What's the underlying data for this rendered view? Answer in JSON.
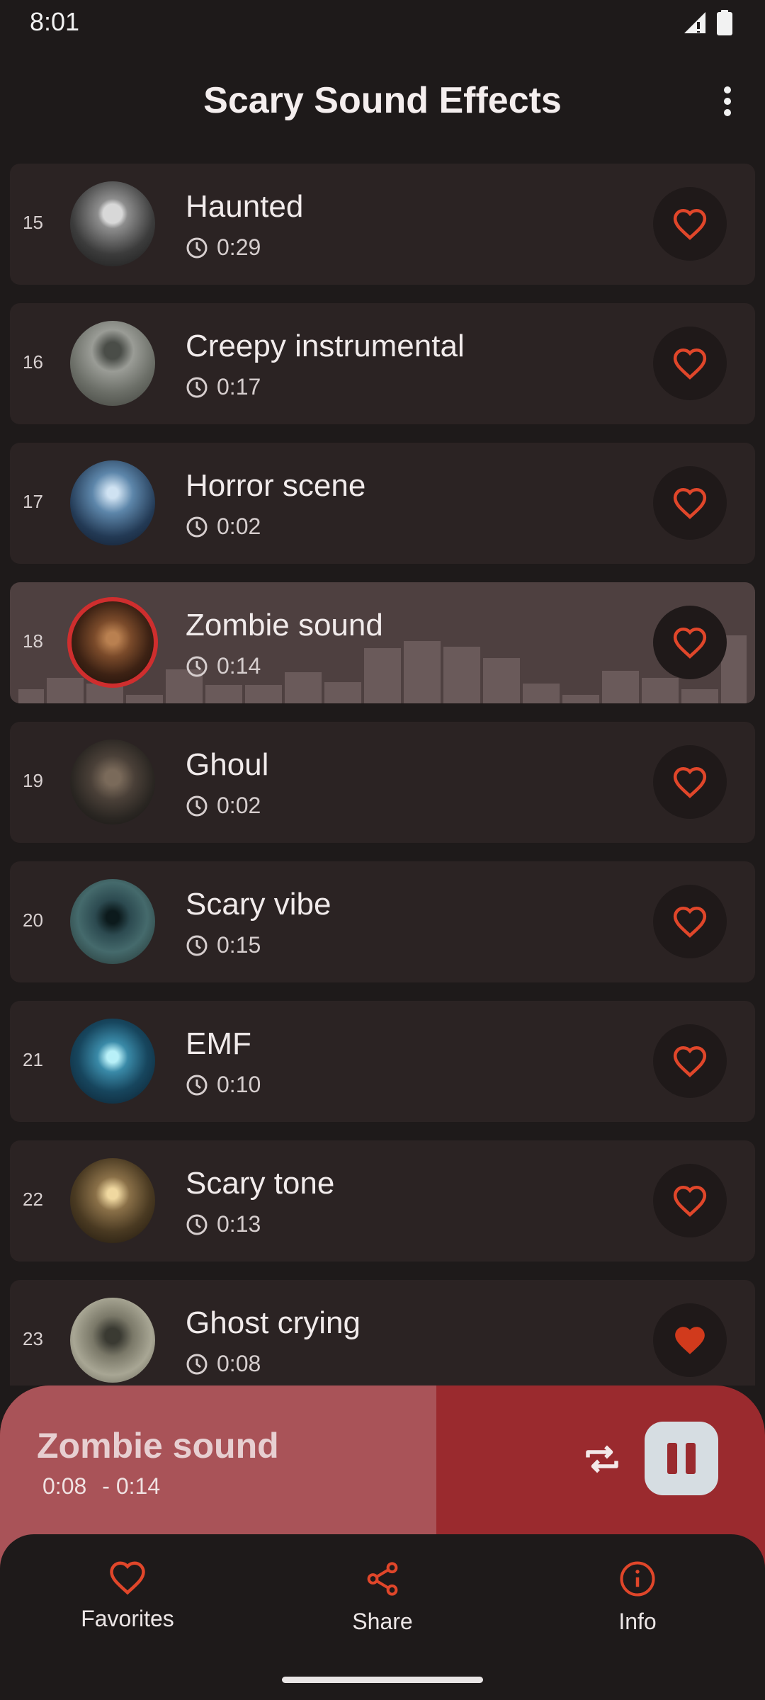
{
  "status": {
    "time": "8:01"
  },
  "app": {
    "title": "Scary Sound Effects"
  },
  "sounds": [
    {
      "num": "15",
      "title": "Haunted",
      "duration": "0:29",
      "favorite": false
    },
    {
      "num": "16",
      "title": "Creepy instrumental",
      "duration": "0:17",
      "favorite": false
    },
    {
      "num": "17",
      "title": "Horror scene",
      "duration": "0:02",
      "favorite": false
    },
    {
      "num": "18",
      "title": "Zombie sound",
      "duration": "0:14",
      "favorite": false,
      "playing": true
    },
    {
      "num": "19",
      "title": "Ghoul",
      "duration": "0:02",
      "favorite": false
    },
    {
      "num": "20",
      "title": "Scary vibe",
      "duration": "0:15",
      "favorite": false
    },
    {
      "num": "21",
      "title": "EMF",
      "duration": "0:10",
      "favorite": false
    },
    {
      "num": "22",
      "title": "Scary tone",
      "duration": "0:13",
      "favorite": false
    },
    {
      "num": "23",
      "title": "Ghost crying",
      "duration": "0:08",
      "favorite": true
    }
  ],
  "player": {
    "title": "Zombie sound",
    "elapsed": "0:08",
    "remaining": "- 0:14",
    "progress": 0.57
  },
  "nav": [
    {
      "label": "Favorites",
      "icon": "heart-icon"
    },
    {
      "label": "Share",
      "icon": "share-icon"
    },
    {
      "label": "Info",
      "icon": "info-icon"
    }
  ],
  "colors": {
    "accent": "#e0462a",
    "player_bg": "#9a2a2e",
    "player_progress": "#a95358",
    "row_bg": "#2b2323",
    "row_active_bg": "#4e4040"
  }
}
